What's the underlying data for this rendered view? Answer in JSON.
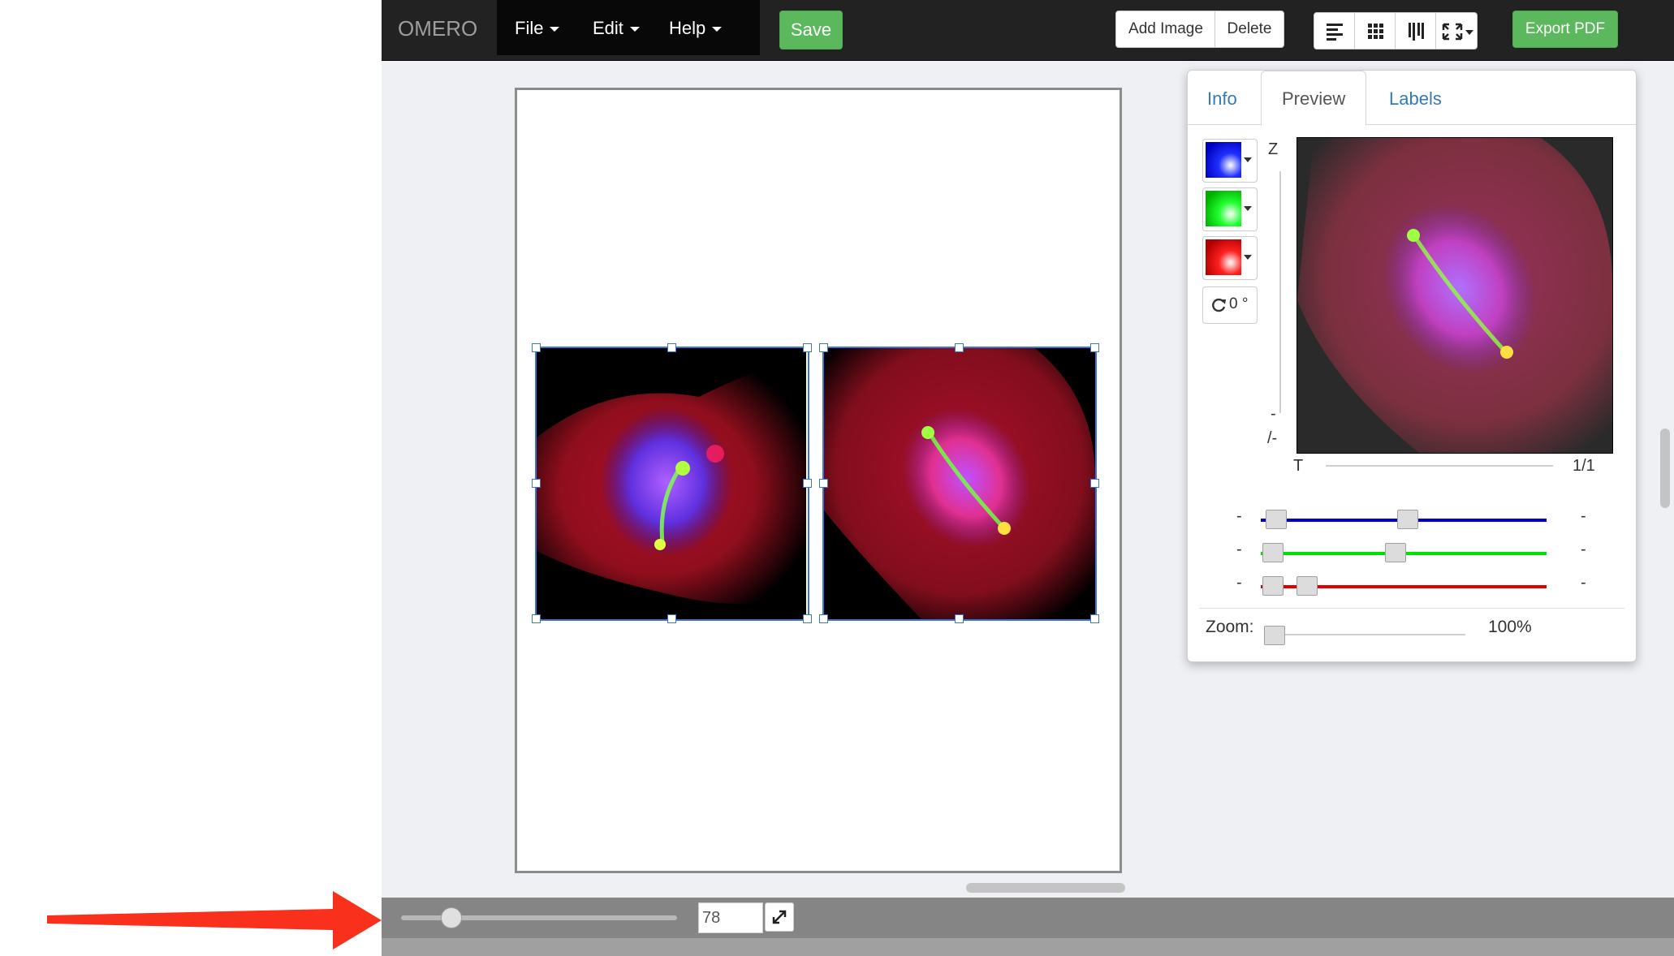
{
  "navbar": {
    "brand": "OMERO",
    "menus": [
      {
        "label": "File"
      },
      {
        "label": "Edit"
      },
      {
        "label": "Help"
      }
    ],
    "save_label": "Save",
    "add_image_label": "Add Image",
    "delete_label": "Delete",
    "export_label": "Export PDF",
    "toolbar_icons": [
      "align-left-icon",
      "grid-icon",
      "distribute-icon",
      "expand-icon"
    ]
  },
  "preview_panel": {
    "tabs": [
      "Info",
      "Preview",
      "Labels"
    ],
    "active_tab": "Preview",
    "channels": [
      {
        "color": "#0000ff"
      },
      {
        "color": "#00ff00"
      },
      {
        "color": "#ff0000"
      }
    ],
    "rotation_label": "0 °",
    "z_label": "Z",
    "z_value": "-",
    "z_total": "/-",
    "t_label": "T",
    "t_value": "1/1",
    "channel_sliders": [
      {
        "color": "#0000cc",
        "min_label": "-",
        "max_label": "-",
        "start": 0.05,
        "end": 0.51
      },
      {
        "color": "#00e000",
        "min_label": "-",
        "max_label": "-",
        "start": 0.04,
        "end": 0.47
      },
      {
        "color": "#e00000",
        "min_label": "-",
        "max_label": "-",
        "start": 0.04,
        "end": 0.16
      }
    ],
    "zoom_label": "Zoom:",
    "zoom_value": "100%"
  },
  "bottom_bar": {
    "zoom_input": "78",
    "zoom_fraction": 0.18
  }
}
